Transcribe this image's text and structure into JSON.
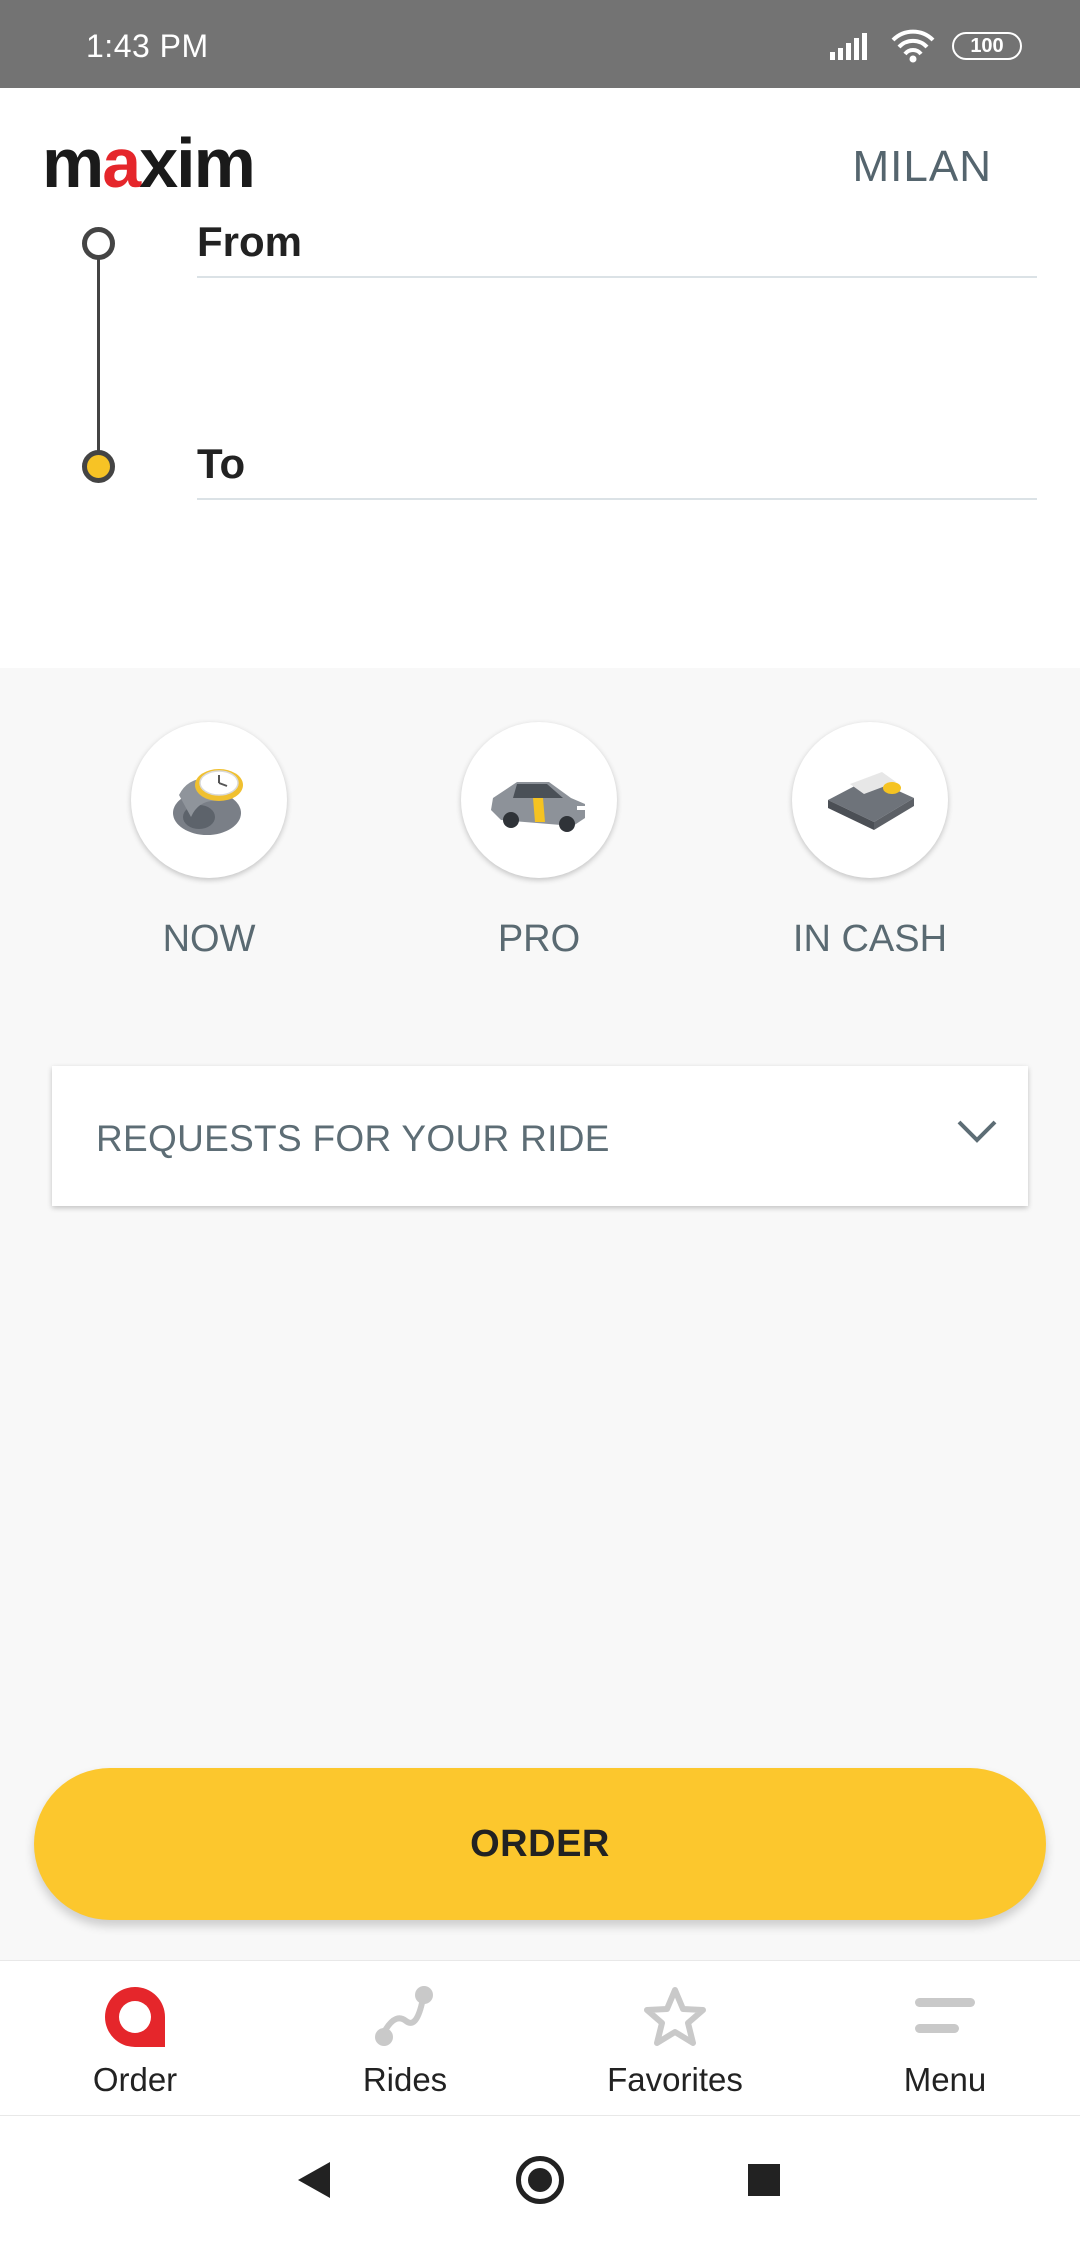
{
  "status_bar": {
    "time": "1:43 PM",
    "battery": "100"
  },
  "header": {
    "logo_prefix": "m",
    "logo_accent": "a",
    "logo_suffix": "xim",
    "city": "MILAN"
  },
  "route": {
    "from_label": "From",
    "to_label": "To"
  },
  "options": [
    {
      "label": "NOW",
      "icon": "clock-icon"
    },
    {
      "label": "PRO",
      "icon": "car-icon"
    },
    {
      "label": "IN CASH",
      "icon": "wallet-icon"
    }
  ],
  "requests": {
    "label": "REQUESTS FOR YOUR RIDE"
  },
  "order_button": {
    "label": "ORDER"
  },
  "bottom_nav": [
    {
      "label": "Order",
      "icon": "order-pin-icon",
      "active": true
    },
    {
      "label": "Rides",
      "icon": "rides-route-icon"
    },
    {
      "label": "Favorites",
      "icon": "star-icon"
    },
    {
      "label": "Menu",
      "icon": "menu-icon"
    }
  ],
  "colors": {
    "accent_yellow": "#fcc72d",
    "brand_red": "#e5262b",
    "status_bar": "#737373"
  }
}
